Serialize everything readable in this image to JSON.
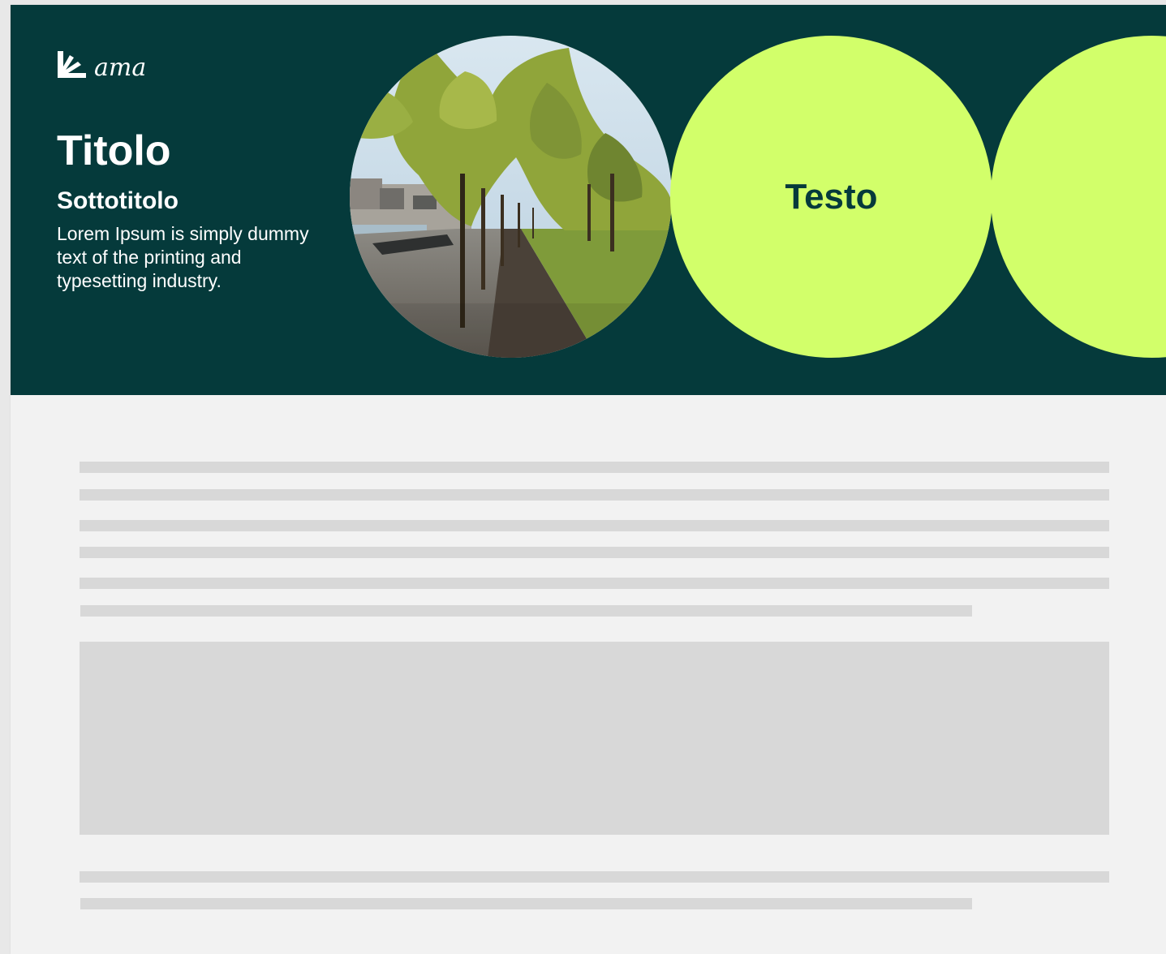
{
  "colors": {
    "hero_bg": "#053a3b",
    "accent": "#d2ff6a",
    "page_bg": "#f2f2f2",
    "placeholder": "#d8d8d8"
  },
  "logo": {
    "icon": "ama-hand-icon",
    "word": "ama"
  },
  "hero": {
    "title": "Titolo",
    "subtitle": "Sottotitolo",
    "body": "Lorem Ipsum is simply dummy text of the printing and typesetting industry.",
    "photo_icon": "tree-lined-riverside-path-photo",
    "circle_text": "Testo"
  }
}
